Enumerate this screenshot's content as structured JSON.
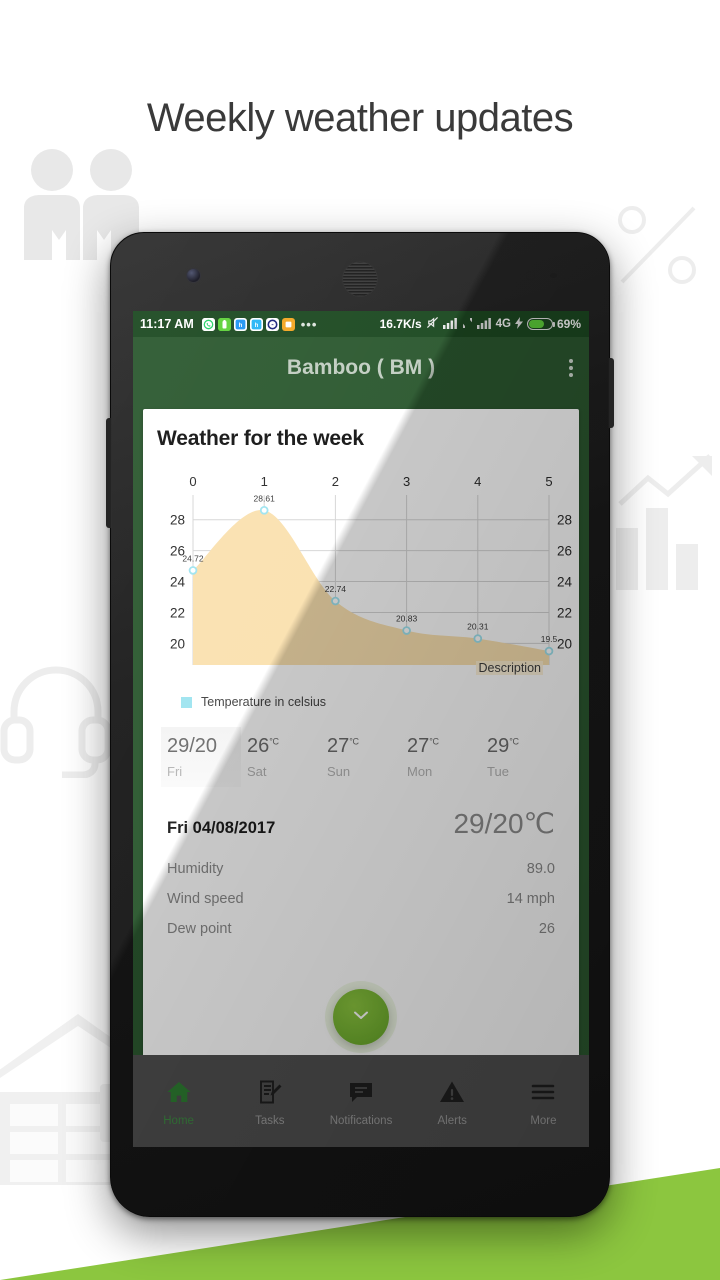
{
  "page": {
    "title": "Weekly weather updates",
    "accent_green": "#8cc63f",
    "appbar_green": "#2c5930",
    "chart_fill": "#fae1b0"
  },
  "watermarks": {
    "people": "people-icon",
    "percent": "percent-icon",
    "headset": "headset-icon",
    "bar_chart": "bar-chart-icon",
    "warehouse": "warehouse-icon",
    "truck": "truck-icon"
  },
  "statusbar": {
    "time": "11:17 AM",
    "app_icons": [
      "whatsapp-icon",
      "battery-app-icon",
      "blue-app-icon",
      "blue-app-icon-2",
      "messenger-icon",
      "orange-app-icon"
    ],
    "more_dots": "•••",
    "data_speed": "16.7K/s",
    "mute_icon": "mute-icon",
    "signal_icon": "signal-bars-icon",
    "data_transfer_icon": "data-transfer-icon",
    "signal_icon_2": "signal-bars-icon",
    "network": "4G",
    "charging_icon": "lightning-bolt-icon",
    "battery_icon": "battery-icon",
    "battery_percent": "69%"
  },
  "appbar": {
    "title": "Bamboo ( BM )",
    "overflow": "overflow-menu-icon"
  },
  "card": {
    "title": "Weather for the week",
    "description_label": "Description",
    "legend": {
      "label": "Temperature in celsius",
      "color": "#9fe4f0"
    }
  },
  "chart_data": {
    "type": "area",
    "title": "Weather for the week",
    "xlabel": "",
    "ylabel": "",
    "x": [
      0,
      1,
      2,
      3,
      4,
      5
    ],
    "values": [
      24.72,
      28.61,
      22.74,
      20.83,
      20.31,
      19.5
    ],
    "point_labels": [
      "24.72",
      "28.61",
      "22.74",
      "20.83",
      "20.31",
      "19.5"
    ],
    "series": [
      {
        "name": "Temperature in celsius",
        "values": [
          24.72,
          28.61,
          22.74,
          20.83,
          20.31,
          19.5
        ]
      }
    ],
    "xticks": [
      "0",
      "1",
      "2",
      "3",
      "4",
      "5"
    ],
    "yticks_left": [
      "28",
      "26",
      "24",
      "22",
      "20"
    ],
    "yticks_right": [
      "28",
      "26",
      "24",
      "22",
      "20"
    ],
    "ylim": [
      18.6,
      29.6
    ],
    "xlim": [
      0,
      5
    ],
    "grid": true,
    "legend_position": "bottom-left",
    "fill_color": "#fae1b0",
    "marker_color": "#9fe4f0",
    "annotation": "Description"
  },
  "days": [
    {
      "temp": "29/20",
      "unit": "",
      "name": "Fri",
      "selected": true
    },
    {
      "temp": "26",
      "unit": "°C",
      "name": "Sat",
      "selected": false
    },
    {
      "temp": "27",
      "unit": "°C",
      "name": "Sun",
      "selected": false
    },
    {
      "temp": "27",
      "unit": "°C",
      "name": "Mon",
      "selected": false
    },
    {
      "temp": "29",
      "unit": "°C",
      "name": "Tue",
      "selected": false
    }
  ],
  "detail": {
    "date": "Fri 04/08/2017",
    "temperature": "29/20℃",
    "rows": [
      {
        "label": "Humidity",
        "value": "89.0"
      },
      {
        "label": "Wind speed",
        "value": "14 mph"
      },
      {
        "label": "Dew point",
        "value": "26"
      }
    ]
  },
  "fab": {
    "icon": "chevron-down-icon"
  },
  "bottomnav": [
    {
      "label": "Home",
      "icon": "home-icon",
      "active": true
    },
    {
      "label": "Tasks",
      "icon": "tasks-icon",
      "active": false
    },
    {
      "label": "Notifications",
      "icon": "notifications-icon",
      "active": false
    },
    {
      "label": "Alerts",
      "icon": "alerts-icon",
      "active": false
    },
    {
      "label": "More",
      "icon": "more-icon",
      "active": false
    }
  ]
}
